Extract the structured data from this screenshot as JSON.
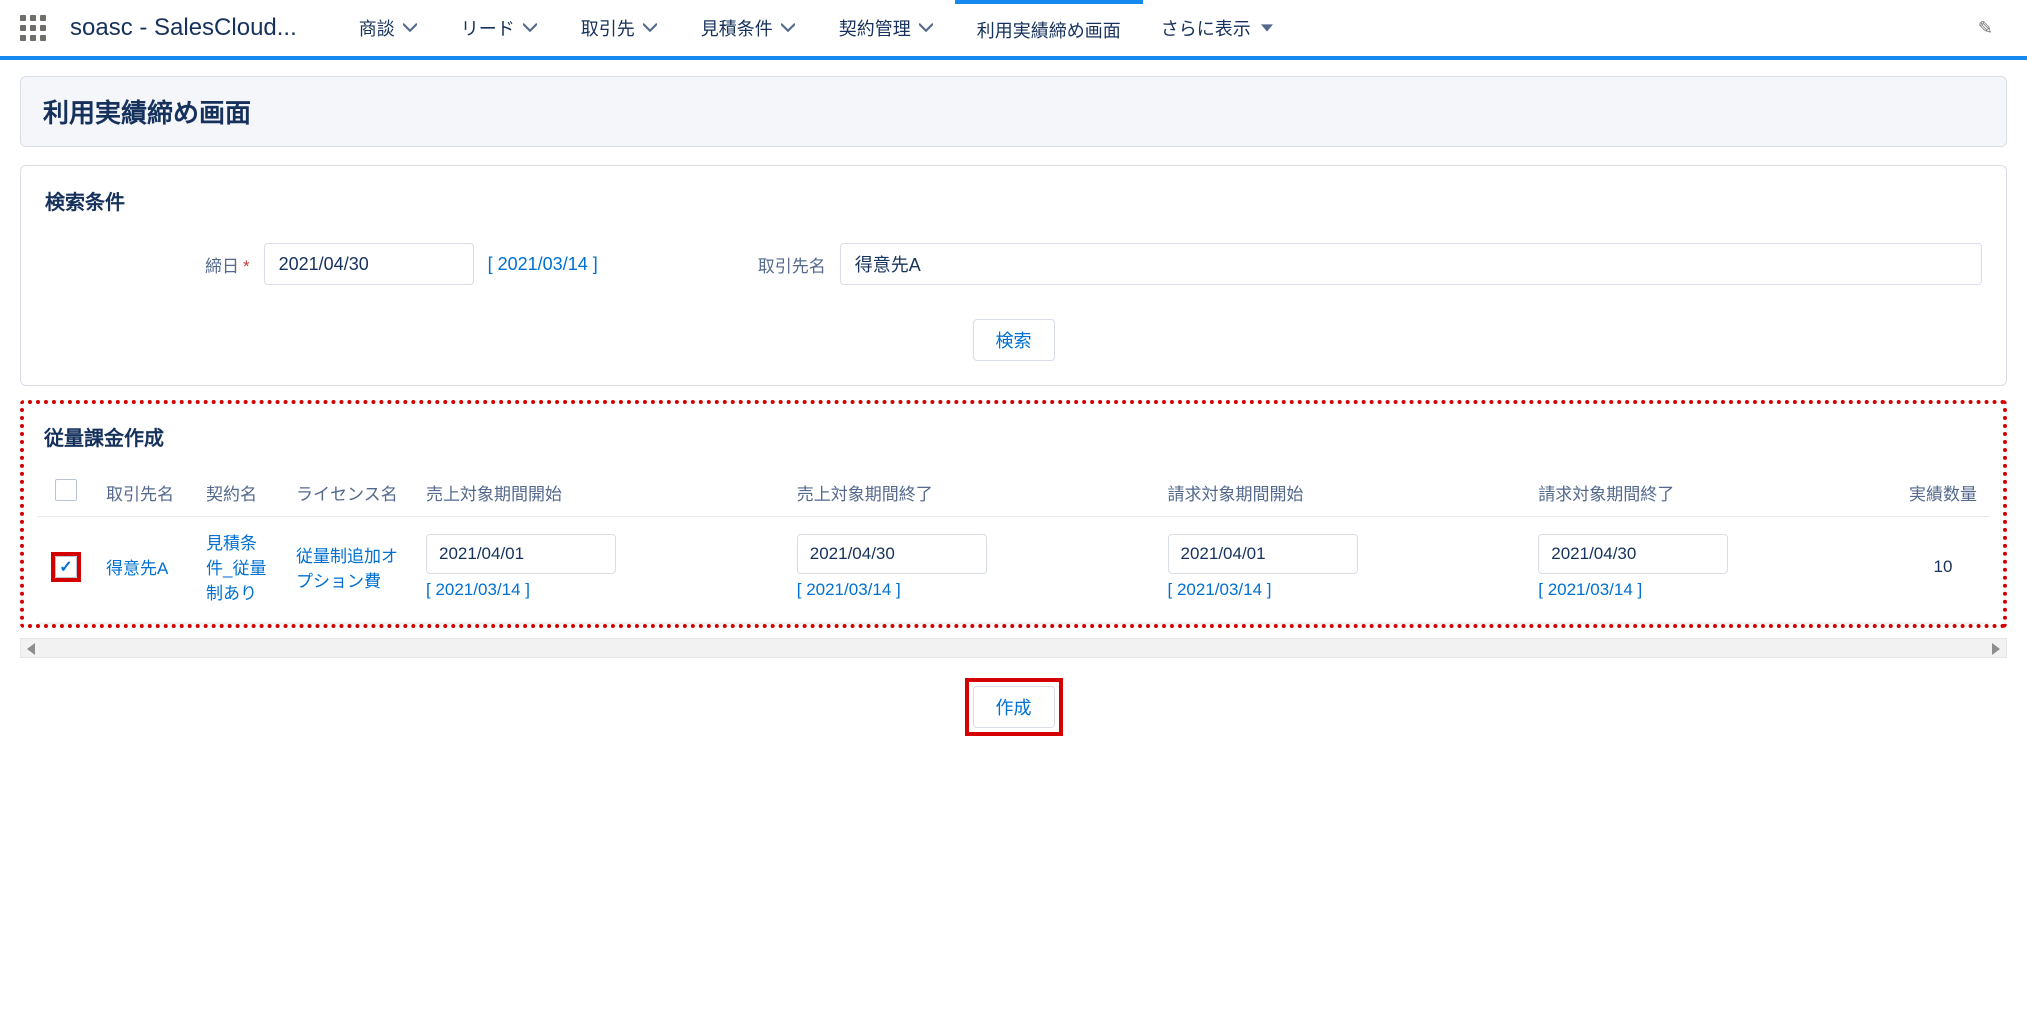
{
  "nav": {
    "app_title": "soasc - SalesCloud...",
    "tabs": [
      {
        "label": "商談",
        "has_menu": true
      },
      {
        "label": "リード",
        "has_menu": true
      },
      {
        "label": "取引先",
        "has_menu": true
      },
      {
        "label": "見積条件",
        "has_menu": true
      },
      {
        "label": "契約管理",
        "has_menu": true
      },
      {
        "label": "利用実績締め画面",
        "has_menu": false,
        "active": true
      }
    ],
    "more_label": "さらに表示"
  },
  "page": {
    "title": "利用実績締め画面"
  },
  "search": {
    "section_title": "検索条件",
    "close_date_label": "締日",
    "close_date_value": "2021/04/30",
    "close_date_hint": "[ 2021/03/14 ]",
    "account_label": "取引先名",
    "account_value": "得意先A",
    "button_label": "検索"
  },
  "billing": {
    "section_title": "従量課金作成",
    "columns": {
      "account": "取引先名",
      "contract": "契約名",
      "license": "ライセンス名",
      "sales_start": "売上対象期間開始",
      "sales_end": "売上対象期間終了",
      "bill_start": "請求対象期間開始",
      "bill_end": "請求対象期間終了",
      "qty": "実績数量"
    },
    "rows": [
      {
        "checked": true,
        "account": "得意先A",
        "contract": "見積条件_従量制あり",
        "license": "従量制追加オプション費",
        "sales_start": "2021/04/01",
        "sales_end": "2021/04/30",
        "bill_start": "2021/04/01",
        "bill_end": "2021/04/30",
        "date_hint": "[ 2021/03/14 ]",
        "qty": "10"
      }
    ],
    "create_button": "作成"
  }
}
